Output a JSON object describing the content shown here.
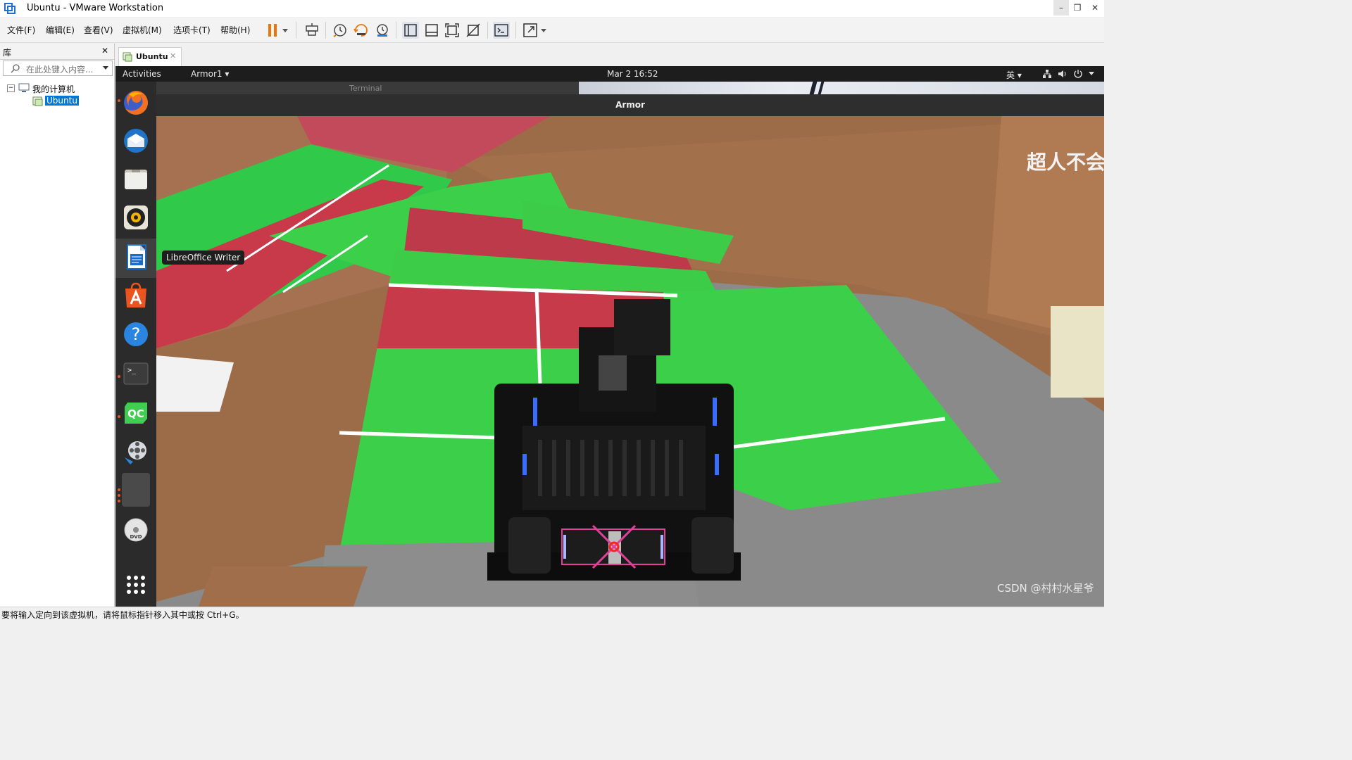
{
  "window": {
    "title": "Ubuntu - VMware Workstation",
    "minimize_glyph": "–",
    "restore_glyph": "❐",
    "close_glyph": "✕"
  },
  "menu": [
    "文件(F)",
    "编辑(E)",
    "查看(V)",
    "虚拟机(M)",
    "选项卡(T)",
    "帮助(H)"
  ],
  "library": {
    "title": "库",
    "close_glyph": "✕",
    "search_placeholder": "在此处键入内容...",
    "tree_root": "我的计算机",
    "tree_vm": "Ubuntu",
    "expander": "−"
  },
  "tab": {
    "label": "Ubuntu",
    "close_glyph": "✕"
  },
  "guest": {
    "activities": "Activities",
    "app_menu": "Armor1 ▾",
    "clock": "Mar 2  16:52",
    "input_method": "英 ▾",
    "window_title": "Armor",
    "behind_window_title": "Terminal",
    "tooltip": "LibreOffice Writer",
    "overlay_text": "超人不会",
    "watermark": "CSDN @村村水星爷",
    "qc_label": "QC"
  },
  "status_bar": {
    "message": "要将输入定向到该虚拟机，请将鼠标指针移入其中或按 Ctrl+G。"
  },
  "colors": {
    "ubuntu_orange": "#e95420",
    "selection_blue": "#0078d7",
    "dock_bg": "#2b2b2b",
    "topbar_bg": "#1d1d1d",
    "armor_box": "#e0409a"
  },
  "icons": {
    "toolbar": [
      "pause-icon",
      "dropdown-icon",
      "send-keys-icon",
      "snapshot-icon",
      "revert-snapshot-icon",
      "snapshot-manager-icon",
      "normal-view-icon",
      "thumbnail-view-icon",
      "fullscreen-icon",
      "unity-icon",
      "console-icon",
      "stretch-icon"
    ],
    "dock": [
      "firefox-icon",
      "thunderbird-icon",
      "files-icon",
      "rhythmbox-icon",
      "libreoffice-writer-icon",
      "software-center-icon",
      "help-icon",
      "terminal-icon",
      "qtcreator-icon",
      "video-editor-icon",
      "dvd-icon",
      "app-grid-icon"
    ]
  }
}
